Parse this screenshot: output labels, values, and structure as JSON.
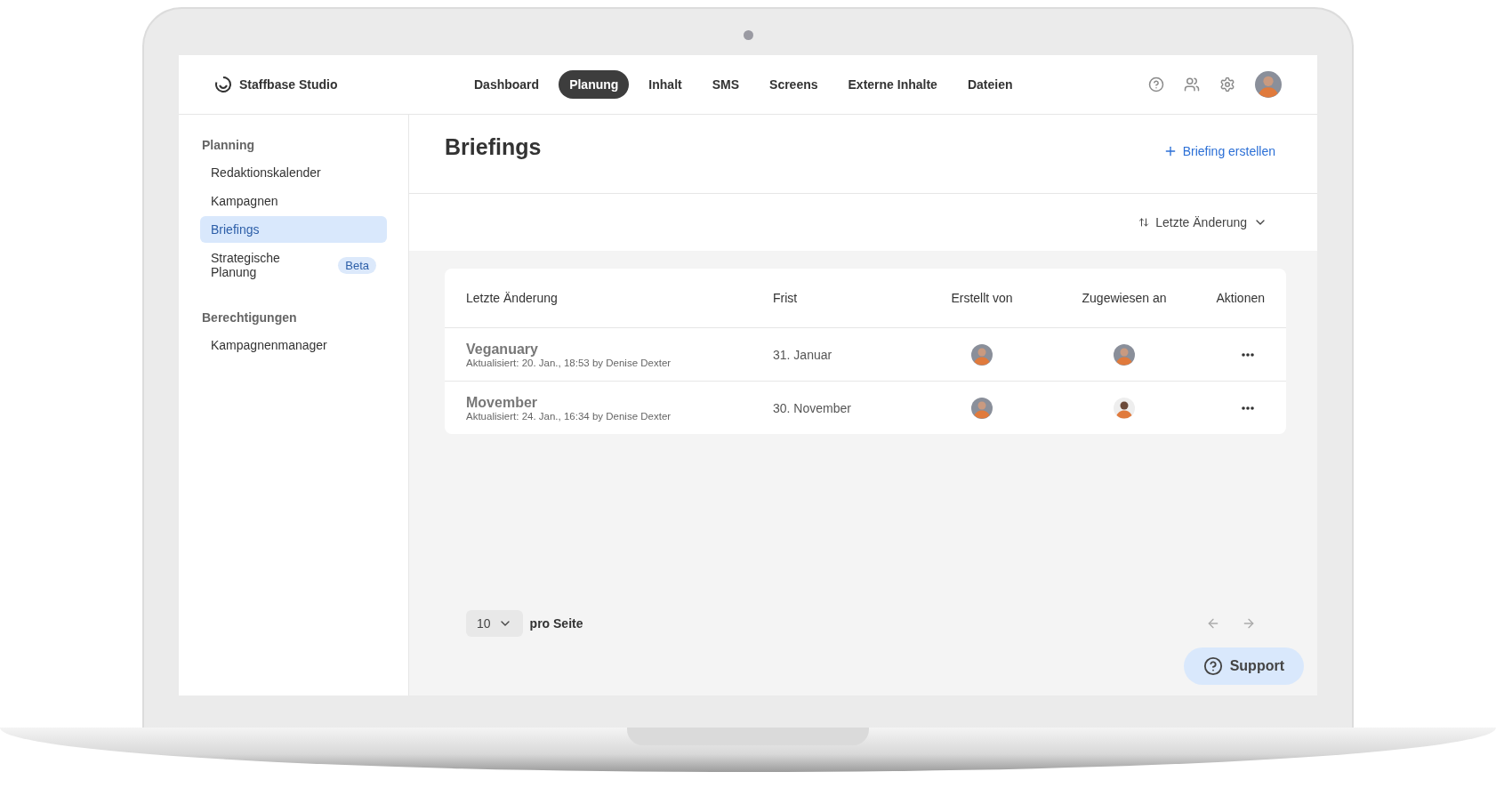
{
  "header": {
    "brand": "Staffbase Studio",
    "nav": [
      {
        "label": "Dashboard",
        "selected": false
      },
      {
        "label": "Planung",
        "selected": true
      },
      {
        "label": "Inhalt",
        "selected": false
      },
      {
        "label": "SMS",
        "selected": false
      },
      {
        "label": "Screens",
        "selected": false
      },
      {
        "label": "Externe Inhalte",
        "selected": false
      },
      {
        "label": "Dateien",
        "selected": false
      }
    ]
  },
  "sidebar": {
    "sections": [
      {
        "title": "Planning",
        "items": [
          {
            "label": "Redaktionskalender",
            "selected": false
          },
          {
            "label": "Kampagnen",
            "selected": false
          },
          {
            "label": "Briefings",
            "selected": true
          },
          {
            "label": "Strategische Planung",
            "selected": false,
            "badge": "Beta"
          }
        ]
      },
      {
        "title": "Berechtigungen",
        "items": [
          {
            "label": "Kampagnenmanager",
            "selected": false
          }
        ]
      }
    ]
  },
  "page": {
    "title": "Briefings",
    "create_button": "Briefing erstellen",
    "sort": "Letzte Änderung"
  },
  "table": {
    "columns": [
      "Letzte Änderung",
      "Frist",
      "Erstellt von",
      "Zugewiesen an",
      "Aktionen"
    ],
    "rows": [
      {
        "title": "Veganuary",
        "meta": "Aktualisiert: 20. Jan., 18:53 by Denise Dexter",
        "deadline": "31. Januar"
      },
      {
        "title": "Movember",
        "meta": "Aktualisiert: 24. Jan., 16:34 by Denise Dexter",
        "deadline": "30. November"
      }
    ]
  },
  "pagination": {
    "page_size": "10",
    "label": "pro Seite"
  },
  "support": "Support"
}
